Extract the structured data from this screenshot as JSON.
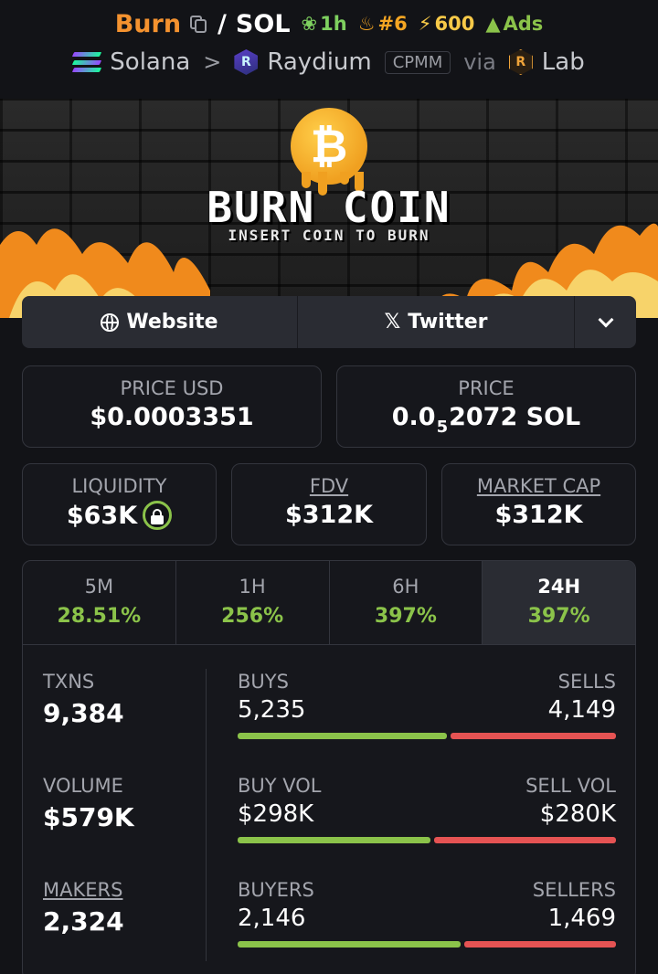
{
  "header": {
    "token": "Burn",
    "slash": "/",
    "quote": "SOL",
    "age_badge": "1h",
    "rank_badge": "#6",
    "boost_badge": "600",
    "ads_badge": "Ads",
    "chain": "Solana",
    "dex": "Raydium",
    "pool_type": "CPMM",
    "via": "via",
    "launchpad": "Lab"
  },
  "banner": {
    "title": "BURN COIN",
    "subtitle": "INSERT COIN TO BURN"
  },
  "links": {
    "website": "Website",
    "twitter": "Twitter"
  },
  "prices": {
    "usd_label": "PRICE USD",
    "usd_value": "$0.0003351",
    "native_label": "PRICE",
    "native_prefix": "0.0",
    "native_zeros": "5",
    "native_suffix": "2072 SOL"
  },
  "metrics": {
    "liquidity_label": "LIQUIDITY",
    "liquidity_value": "$63K",
    "fdv_label": "FDV",
    "fdv_value": "$312K",
    "mcap_label": "MARKET CAP",
    "mcap_value": "$312K"
  },
  "timeframes": [
    {
      "label": "5M",
      "change": "28.51%"
    },
    {
      "label": "1H",
      "change": "256%"
    },
    {
      "label": "6H",
      "change": "397%"
    },
    {
      "label": "24H",
      "change": "397%"
    }
  ],
  "active_timeframe": "24H",
  "stats": {
    "txns": {
      "label": "TXNS",
      "value": "9,384",
      "left_label": "BUYS",
      "left_value": "5,235",
      "right_label": "SELLS",
      "right_value": "4,149",
      "buy_fraction": 0.558
    },
    "volume": {
      "label": "VOLUME",
      "value": "$579K",
      "left_label": "BUY VOL",
      "left_value": "$298K",
      "right_label": "SELL VOL",
      "right_value": "$280K",
      "buy_fraction": 0.515
    },
    "makers": {
      "label": "MAKERS",
      "value": "2,324",
      "left_label": "BUYERS",
      "left_value": "2,146",
      "right_label": "SELLERS",
      "right_value": "1,469",
      "buy_fraction": 0.594
    }
  },
  "colors": {
    "background": "#121317",
    "token_accent": "#f4922f",
    "positive": "#8bc34a",
    "negative": "#e55353",
    "muted_text": "#a3a5ad"
  }
}
